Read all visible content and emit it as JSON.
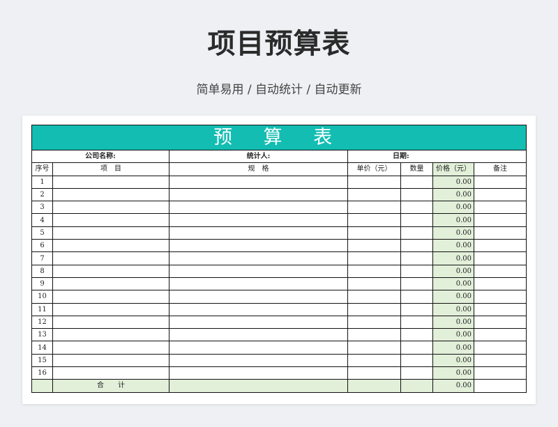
{
  "page": {
    "title": "项目预算表",
    "subtitle": "简单易用 / 自动统计 / 自动更新"
  },
  "sheet": {
    "title": "预 算 表",
    "info": {
      "company_label": "公司名称:",
      "stats_person_label": "统计人:",
      "date_label": "日期:"
    },
    "columns": [
      "序号",
      "项　目",
      "规　格",
      "单价（元）",
      "数量",
      "价格（元）",
      "备注"
    ],
    "rows": [
      {
        "no": "1",
        "price": "0.00"
      },
      {
        "no": "2",
        "price": "0.00"
      },
      {
        "no": "3",
        "price": "0.00"
      },
      {
        "no": "4",
        "price": "0.00"
      },
      {
        "no": "5",
        "price": "0.00"
      },
      {
        "no": "6",
        "price": "0.00"
      },
      {
        "no": "7",
        "price": "0.00"
      },
      {
        "no": "8",
        "price": "0.00"
      },
      {
        "no": "9",
        "price": "0.00"
      },
      {
        "no": "10",
        "price": "0.00"
      },
      {
        "no": "11",
        "price": "0.00"
      },
      {
        "no": "12",
        "price": "0.00"
      },
      {
        "no": "13",
        "price": "0.00"
      },
      {
        "no": "14",
        "price": "0.00"
      },
      {
        "no": "15",
        "price": "0.00"
      },
      {
        "no": "16",
        "price": "0.00"
      }
    ],
    "total": {
      "label": "合　　计",
      "price": "0.00"
    },
    "colors": {
      "title_bg": "#13bdb2",
      "price_fill": "#e2efd9"
    }
  }
}
